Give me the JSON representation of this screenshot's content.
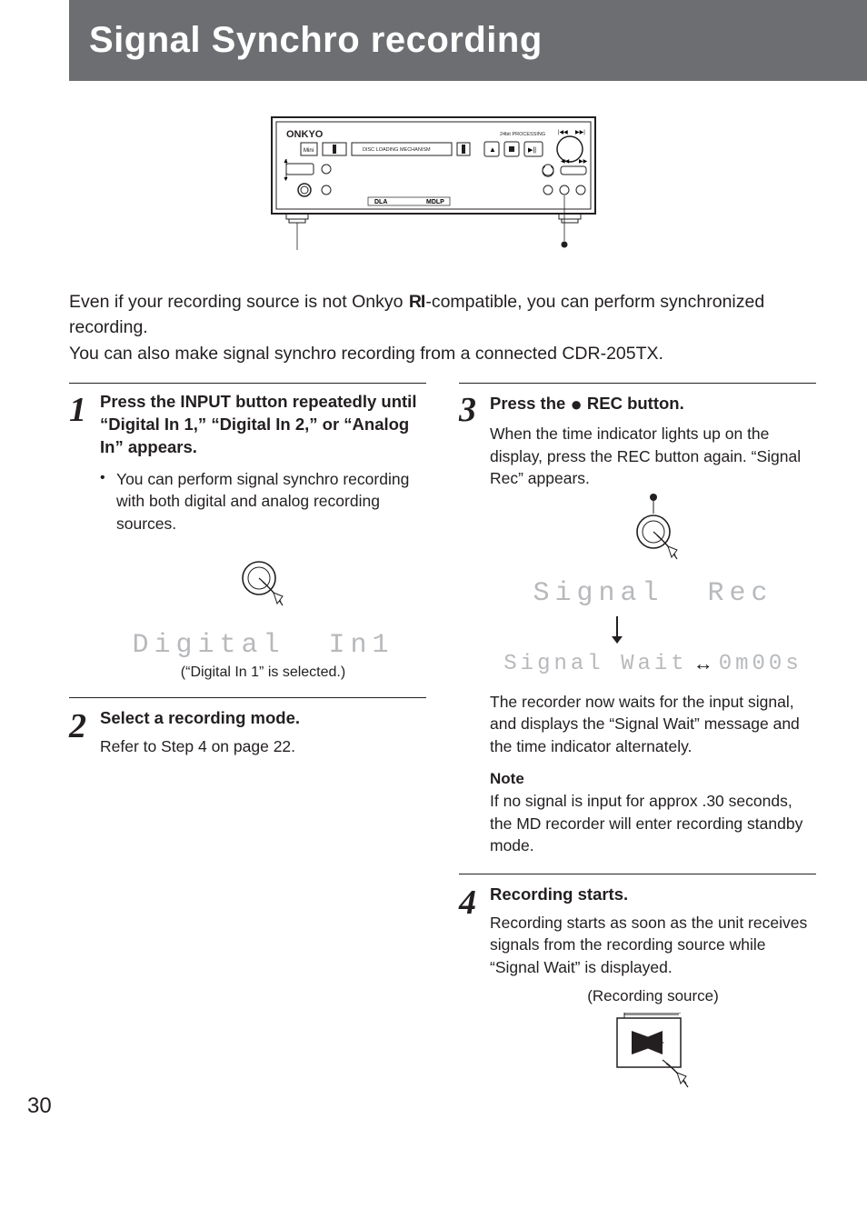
{
  "header": {
    "title": "Signal Synchro recording"
  },
  "device_diagram": {
    "brand": "ONKYO",
    "labels": {
      "disc_loading": "DISC LOADING MECHANISM",
      "processing": "24bit PROCESSING",
      "mdlp": "MDLP",
      "dla": "DLA"
    }
  },
  "intro": {
    "line1_pre": "Even if your recording source is not Onkyo ",
    "ri_symbol": "RI",
    "line1_post": "-compatible, you can perform synchronized recording.",
    "line2": "You can also make signal synchro recording from a connected CDR-205TX."
  },
  "steps": {
    "s1": {
      "num": "1",
      "head": "Press the INPUT button repeatedly until “Digital In 1,” “Digital In 2,” or “Analog In” appears.",
      "bullet": "You can perform signal synchro recording with both digital and analog recording sources.",
      "lcd": "Digital  In1",
      "caption": "(“Digital In 1” is selected.)"
    },
    "s2": {
      "num": "2",
      "head": "Select a recording mode.",
      "text": "Refer to Step 4 on page 22."
    },
    "s3": {
      "num": "3",
      "head_pre": "Press the ",
      "head_post": " REC button.",
      "text1": "When the time indicator lights up on the display, press the REC button again. “Signal Rec” appears.",
      "lcd1": "Signal  Rec",
      "lcd2a": "Signal Wait",
      "lcd2b": "0m00s",
      "text2": "The recorder now waits for the input signal, and displays the “Signal Wait” message and the time indicator alternately.",
      "note_head": "Note",
      "note_text": "If no signal is input for approx .30 seconds, the MD recorder will enter recording standby mode."
    },
    "s4": {
      "num": "4",
      "head": "Recording starts.",
      "text": "Recording starts as soon as the unit receives signals from the recording source while “Signal Wait” is displayed.",
      "src_caption": "(Recording source)"
    }
  },
  "page_number": "30"
}
